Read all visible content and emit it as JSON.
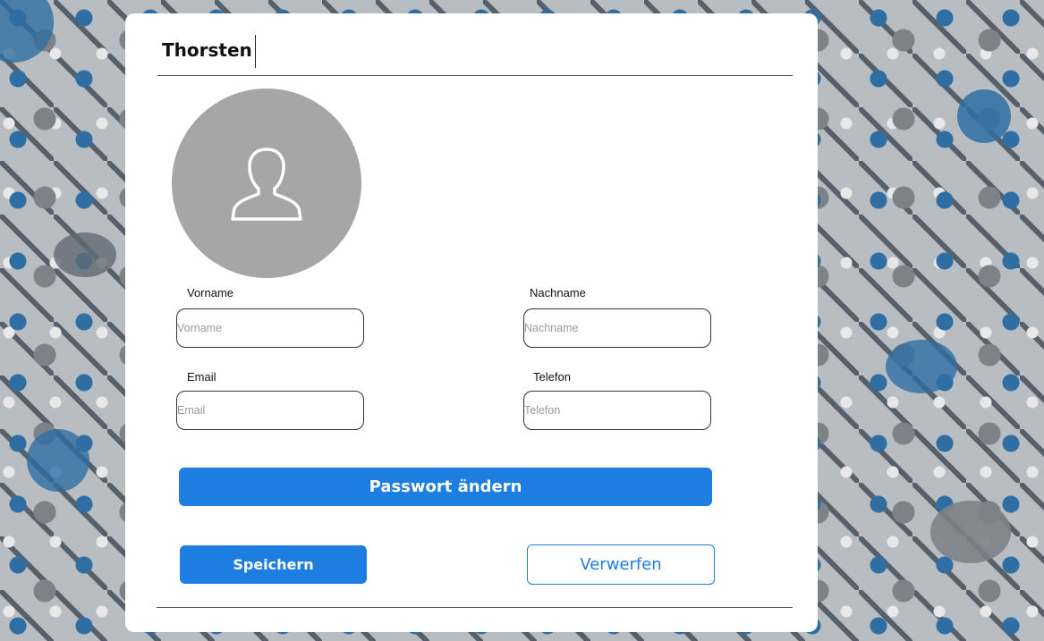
{
  "profile": {
    "name": "Thorsten"
  },
  "form": {
    "vorname": {
      "label": "Vorname",
      "placeholder": "Vorname",
      "value": ""
    },
    "nachname": {
      "label": "Nachname",
      "placeholder": "Nachname",
      "value": ""
    },
    "email": {
      "label": "Email",
      "placeholder": "Email",
      "value": ""
    },
    "telefon": {
      "label": "Telefon",
      "placeholder": "Telefon",
      "value": ""
    }
  },
  "buttons": {
    "change_password": "Passwort ändern",
    "save": "Speichern",
    "discard": "Verwerfen"
  },
  "colors": {
    "accent": "#1e7de0",
    "avatar_bg": "#a6a6a6",
    "card_bg": "#ffffff"
  },
  "icons": {
    "avatar": "user-silhouette-icon"
  }
}
